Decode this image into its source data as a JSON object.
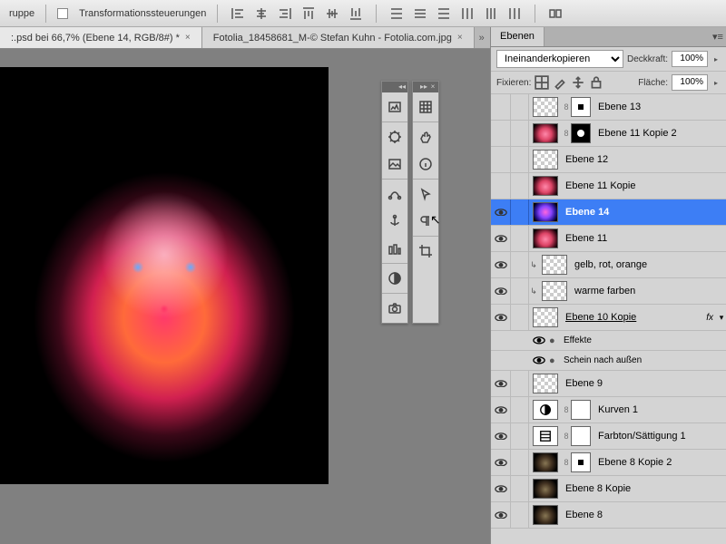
{
  "toolbar": {
    "group_label": "ruppe",
    "transform_checkbox": "Transformationssteuerungen"
  },
  "tabs": {
    "doc1": ":.psd bei 66,7% (Ebene 14, RGB/8#) *",
    "doc2": "Fotolia_18458681_M-© Stefan Kuhn - Fotolia.com.jpg"
  },
  "panel": {
    "title": "Ebenen",
    "blend_mode": "Ineinanderkopieren",
    "opacity_label": "Deckkraft:",
    "opacity_value": "100%",
    "lock_label": "Fixieren:",
    "fill_label": "Fläche:",
    "fill_value": "100%"
  },
  "layers": {
    "l1": "Ebene 13",
    "l2": "Ebene 11 Kopie 2",
    "l3": "Ebene 12",
    "l4": "Ebene 11 Kopie",
    "l5": "Ebene 14",
    "l6": "Ebene 11",
    "l7": "gelb, rot, orange",
    "l8": "warme farben",
    "l9": "Ebene 10 Kopie",
    "l9fx": "fx",
    "eff": "Effekte",
    "eff1": "Schein nach außen",
    "l10": "Ebene 9",
    "l11": "Kurven 1",
    "l12": "Farbton/Sättigung 1",
    "l13": "Ebene 8 Kopie 2",
    "l14": "Ebene 8 Kopie",
    "l15": "Ebene 8"
  }
}
